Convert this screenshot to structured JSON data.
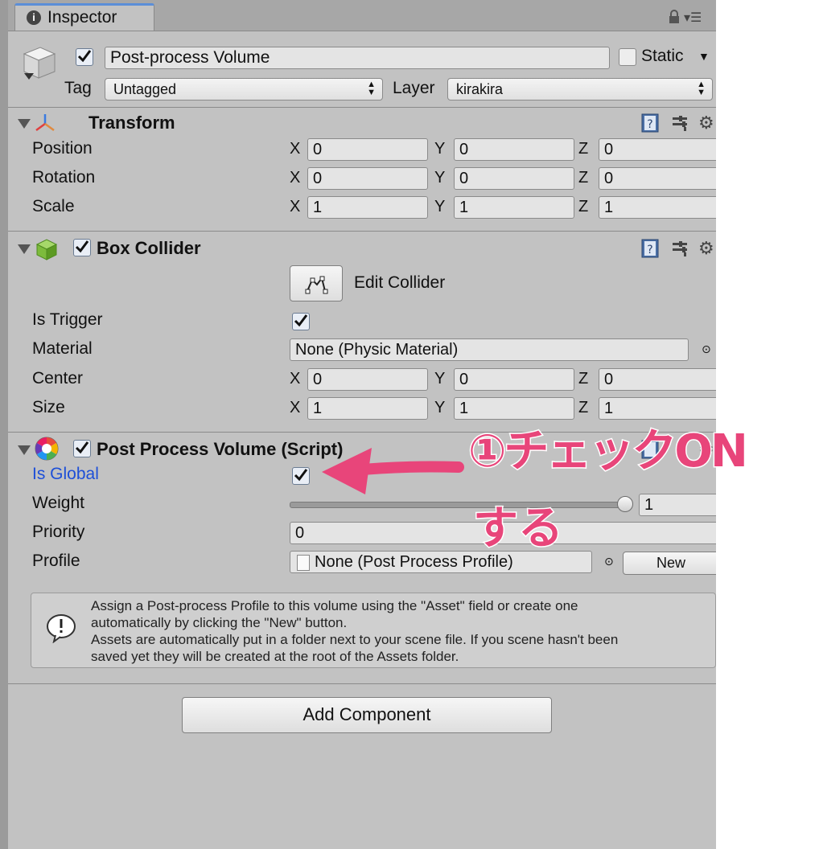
{
  "tab": {
    "title": "Inspector"
  },
  "gameobject": {
    "name": "Post-process Volume",
    "static_label": "Static",
    "tag_label": "Tag",
    "tag_value": "Untagged",
    "layer_label": "Layer",
    "layer_value": "kirakira"
  },
  "transform": {
    "title": "Transform",
    "rows": [
      {
        "label": "Position",
        "x": "0",
        "y": "0",
        "z": "0"
      },
      {
        "label": "Rotation",
        "x": "0",
        "y": "0",
        "z": "0"
      },
      {
        "label": "Scale",
        "x": "1",
        "y": "1",
        "z": "1"
      }
    ]
  },
  "box_collider": {
    "title": "Box Collider",
    "edit_label": "Edit Collider",
    "is_trigger_label": "Is Trigger",
    "material_label": "Material",
    "material_value": "None (Physic Material)",
    "center": {
      "label": "Center",
      "x": "0",
      "y": "0",
      "z": "0"
    },
    "size": {
      "label": "Size",
      "x": "1",
      "y": "1",
      "z": "1"
    }
  },
  "axes": {
    "x": "X",
    "y": "Y",
    "z": "Z"
  },
  "post_process": {
    "title": "Post Process Volume (Script)",
    "is_global_label": "Is Global",
    "weight_label": "Weight",
    "weight_value": "1",
    "weight_fraction": 1,
    "priority_label": "Priority",
    "priority_value": "0",
    "profile_label": "Profile",
    "profile_value": "None (Post Process Profile)",
    "new_label": "New",
    "help_lines": [
      "Assign a Post-process Profile to this volume using the \"Asset\" field or create one",
      "automatically by clicking the \"New\" button.",
      "Assets are automatically put in a folder next to your scene file. If you scene hasn't been",
      "saved yet they will be created at the root of the Assets folder."
    ]
  },
  "add_component_label": "Add Component",
  "annotation": {
    "line1": "①チェックON",
    "line2": "する",
    "color": "#e8457a"
  }
}
